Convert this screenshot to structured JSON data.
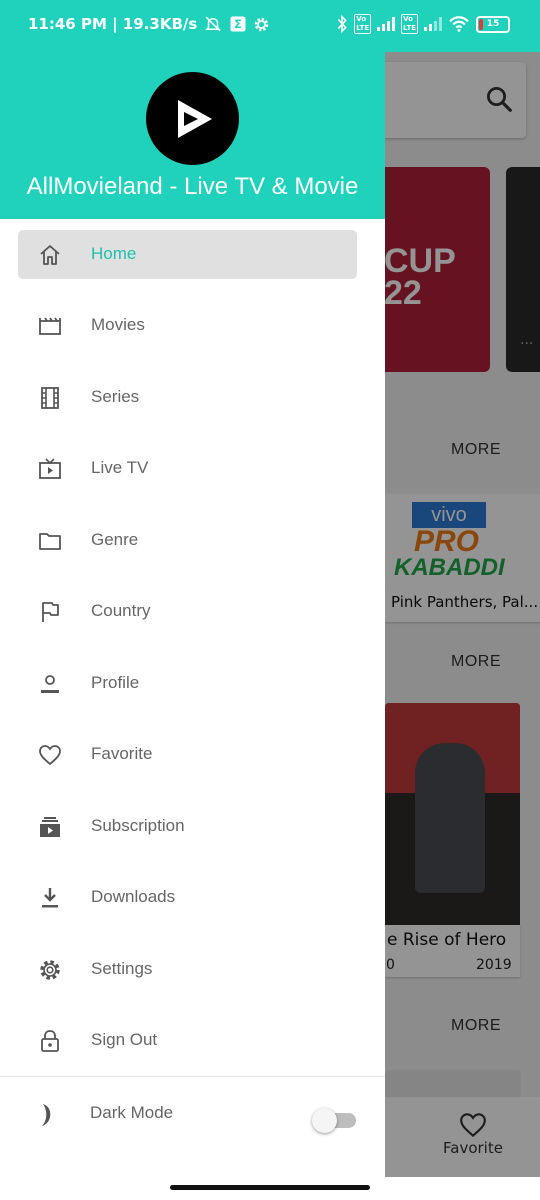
{
  "status_bar": {
    "time_speed": "11:46 PM | 19.3KB/s",
    "battery": "15",
    "battery_level": 0.15,
    "battery_color": "#e53935",
    "icons": [
      "muted-bell-icon",
      "sim-app-icon",
      "gear-icon",
      "bluetooth-icon",
      "volte-icon",
      "signal-icon",
      "wifi-icon",
      "battery-icon"
    ]
  },
  "drawer": {
    "accent": "#20d2bc",
    "app_name": "AllMovieland - Live TV & Movie",
    "items": [
      {
        "label": "Home",
        "icon": "home-icon",
        "active": true
      },
      {
        "label": "Movies",
        "icon": "clapperboard-icon"
      },
      {
        "label": "Series",
        "icon": "film-strip-icon"
      },
      {
        "label": "Live TV",
        "icon": "tv-icon"
      },
      {
        "label": "Genre",
        "icon": "folder-icon"
      },
      {
        "label": "Country",
        "icon": "flag-icon"
      },
      {
        "label": "Profile",
        "icon": "person-icon"
      },
      {
        "label": "Favorite",
        "icon": "heart-icon"
      },
      {
        "label": "Subscription",
        "icon": "subscriptions-icon"
      },
      {
        "label": "Downloads",
        "icon": "download-icon"
      },
      {
        "label": "Settings",
        "icon": "gear-icon"
      },
      {
        "label": "Sign Out",
        "icon": "lock-icon"
      }
    ],
    "dark_mode": {
      "label": "Dark Mode",
      "enabled": false
    }
  },
  "background": {
    "more_labels": [
      "MORE",
      "MORE",
      "MORE"
    ],
    "card1_text_line1": "CUP",
    "card1_text_line2": "22",
    "card2_dots": "...",
    "kabaddi_vivo": "vivo",
    "kabaddi_pro": "PRO",
    "kabaddi_kabaddi": "KABADDI",
    "kabaddi_title": "Pink Panthers, Pal...",
    "poster_title": "e Rise of Hero",
    "poster_year": "2019",
    "poster_left_fragment": "0",
    "favorite_label": "Favorite"
  }
}
